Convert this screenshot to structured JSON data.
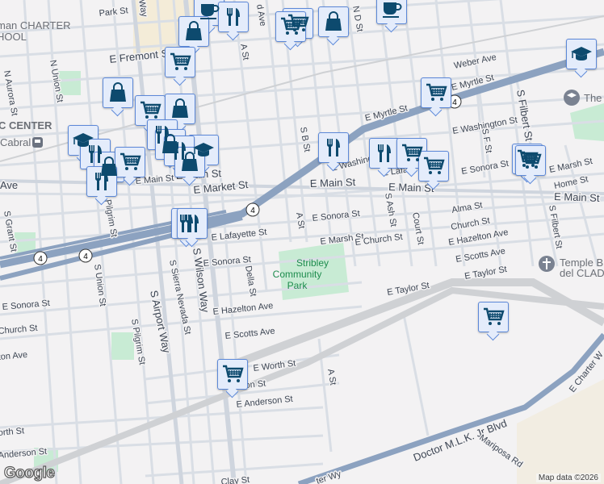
{
  "map": {
    "attribution": "Map data ©2026",
    "logo": "Google",
    "highway_shield": "4",
    "colors": {
      "background": "#f3f2f3",
      "highway": "#8ca2c0",
      "street": "#d9dee5",
      "park": "#c8ebd4",
      "marker_fill": "#e4ecfb",
      "marker_border": "#5c88d8",
      "icon": "#0d4a6e"
    },
    "labels": [
      "Park St",
      "man CHARTER",
      "HOOL",
      "E Fremont St",
      "N Union St",
      "N Aurora St",
      "C CENTER",
      "Cabral",
      "E Main St",
      "E Main St",
      "E Market St",
      "Ave",
      "S Grant St",
      "Pilgrim St",
      "A St",
      "S B St",
      "N D St",
      "E Lafayette St",
      "E Sonora St",
      "Della St",
      "E Hazelton Ave",
      "E Scotts Ave",
      "E Worth St",
      "E Anderson St",
      "S Union St",
      "S Sierra Nevada St",
      "S Airport Way",
      "S Wilson Way",
      "S Pilgrim St",
      "E Sonora St",
      "Church St",
      "ton Ave",
      "orth St",
      "Anderson St",
      "E Sonora St",
      "E Marsh St",
      "E Church St",
      "A St",
      "E Main St",
      "E Main St",
      "E Main St",
      "E Myrtle St",
      "E Myrtle St",
      "Weber Ave",
      "E Washington St",
      "E Washing",
      "S F St",
      "S Filbert St",
      "S Ash St",
      "Court St",
      "E Sonora St",
      "Alma St",
      "Church St",
      "E Hazelton Ave",
      "E Scotts Ave",
      "E Taylor St",
      "E Taylor St",
      "E Marsh St",
      "Home St",
      "S Filbert St",
      "Temple B",
      "del CLAD",
      "The",
      "A St",
      "Doctor M.L.K. Jr Blvd",
      "Mariposa Rd",
      "E Charter W",
      "ter Wy",
      "Clay St",
      "Way",
      "d Ave",
      "E Lafa",
      "Stribley",
      "Community",
      "Park",
      "ilton St"
    ],
    "markers": [
      "coffee-cup",
      "fork-knife",
      "shopping-bag",
      "shopping-cart",
      "shopping-cart",
      "shopping-bag",
      "coffee-cup",
      "shopping-cart",
      "shopping-bag",
      "shopping-cart",
      "shopping-bag",
      "fork-knife",
      "graduation-cap",
      "fork-knife",
      "shopping-bag",
      "shopping-cart",
      "fork-knife",
      "graduation-cap",
      "shopping-bag",
      "fork-knife",
      "fork-knife",
      "fork-knife",
      "fork-knife",
      "shopping-cart",
      "shopping-cart",
      "shopping-cart",
      "graduation-cap",
      "shopping-cart",
      "shopping-cart",
      "shopping-cart",
      "shopping-cart"
    ]
  }
}
